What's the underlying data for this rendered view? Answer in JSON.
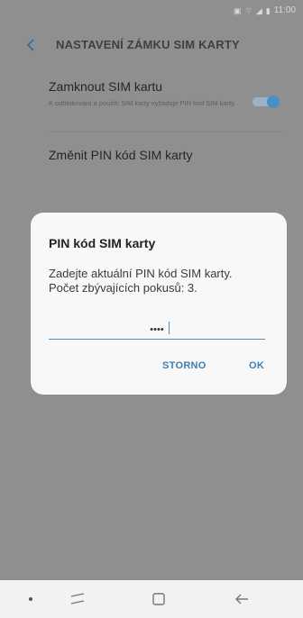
{
  "status_bar": {
    "time": "11:00"
  },
  "app_bar": {
    "title": "NASTAVENÍ ZÁMKU SIM KARTY"
  },
  "settings": {
    "lock_sim": {
      "title": "Zamknout SIM kartu",
      "subtitle": "K odblokování a použití SIM karty vyžaduje PIN kód SIM karty.",
      "enabled": true
    },
    "change_pin": {
      "title": "Změnit PIN kód SIM karty"
    }
  },
  "dialog": {
    "title": "PIN kód SIM karty",
    "message_line1": "Zadejte aktuální PIN kód SIM karty.",
    "message_line2": "Počet zbývajících pokusů: 3.",
    "pin_value": "••••",
    "cancel_label": "STORNO",
    "ok_label": "OK"
  },
  "colors": {
    "accent": "#4a90c4",
    "scrim": "#8f8f8f"
  }
}
